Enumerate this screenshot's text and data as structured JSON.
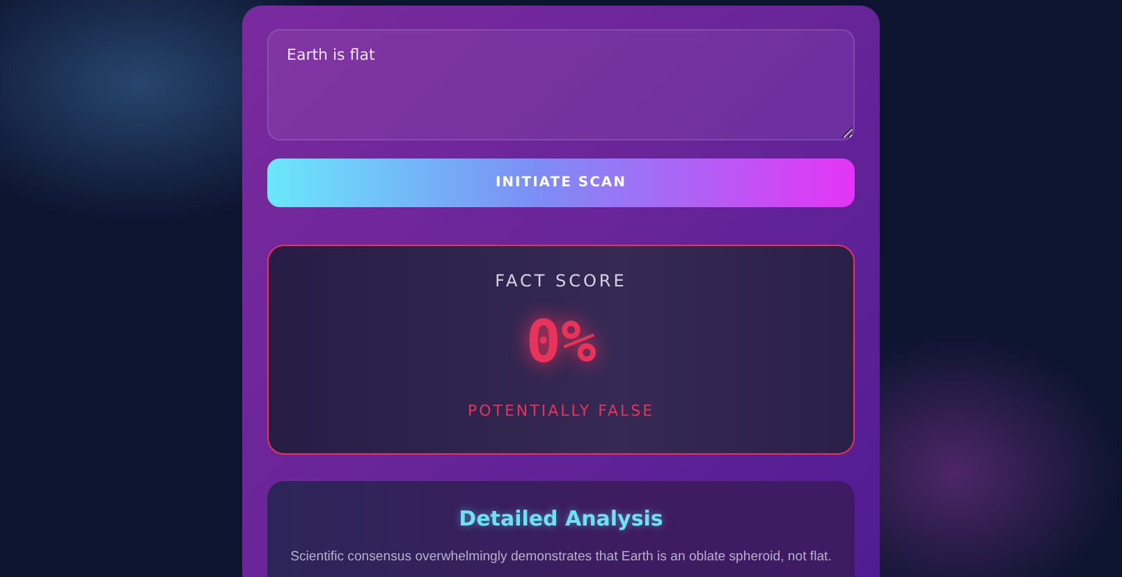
{
  "claim_input": {
    "value": "Earth is flat"
  },
  "scan_button": {
    "label": "INITIATE SCAN"
  },
  "score_panel": {
    "title": "FACT SCORE",
    "score": "0%",
    "verdict": "POTENTIALLY FALSE",
    "kind": "false"
  },
  "analysis": {
    "title": "Detailed Analysis",
    "paragraph_lines": [
      "Scientific consensus overwhelmingly demonstrates that Earth is an oblate spheroid, not flat."
    ]
  }
}
